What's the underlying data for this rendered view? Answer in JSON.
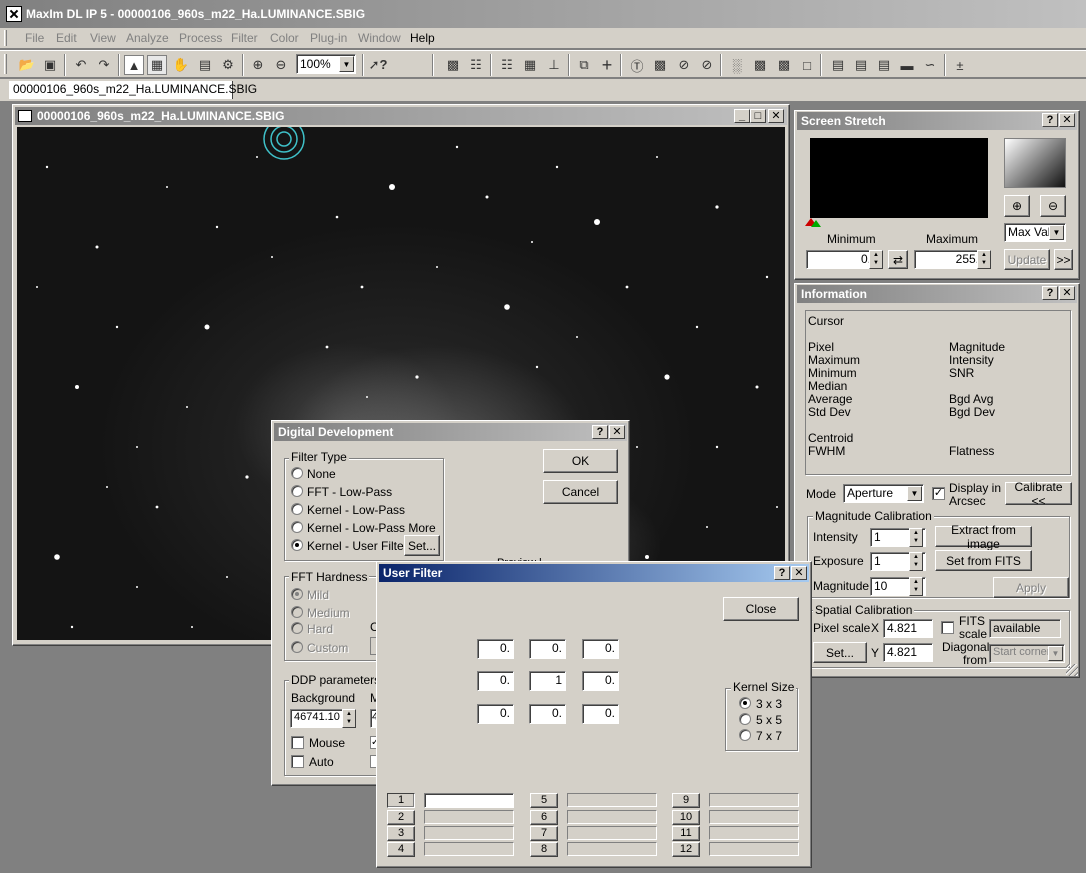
{
  "app": {
    "title": "MaxIm DL IP 5 - 00000106_960s_m22_Ha.LUMINANCE.SBIG",
    "menu": [
      "File",
      "Edit",
      "View",
      "Analyze",
      "Process",
      "Filter",
      "Color",
      "Plug-in",
      "Window",
      "Help"
    ],
    "zoom": "100%",
    "doc_tab": "00000106_960s_m22_Ha.LUMINANCE.SBIG"
  },
  "image_window": {
    "title": "00000106_960s_m22_Ha.LUMINANCE.SBIG"
  },
  "screen_stretch": {
    "title": "Screen Stretch",
    "minimum_label": "Minimum",
    "maximum_label": "Maximum",
    "min_value": "0.",
    "max_value": "255.",
    "mode": "Max Val",
    "update": "Update",
    "more": ">>"
  },
  "information": {
    "title": "Information",
    "cursor": "Cursor",
    "left_labels": [
      "Pixel",
      "Maximum",
      "Minimum",
      "Median",
      "Average",
      "Std Dev"
    ],
    "right_labels": [
      "Magnitude",
      "Intensity",
      "SNR",
      "Bgd Avg",
      "Bgd Dev"
    ],
    "centroid": "Centroid",
    "fwhm": "FWHM",
    "flatness": "Flatness",
    "mode_label": "Mode",
    "mode_value": "Aperture",
    "display_arcsec_1": "Display in",
    "display_arcsec_2": "Arcsec",
    "calibrate": "Calibrate <<",
    "mag_cal_label": "Magnitude Calibration",
    "intensity_label": "Intensity",
    "intensity_value": "1",
    "exposure_label": "Exposure",
    "exposure_value": "1",
    "magnitude_label": "Magnitude",
    "magnitude_value": "10",
    "extract": "Extract from image",
    "set_fits": "Set from FITS",
    "apply": "Apply",
    "spatial_cal_label": "Spatial Calibration",
    "pixel_scale_label": "Pixel scale",
    "x_label": "X",
    "x_value": "4.821",
    "y_label": "Y",
    "y_value": "4.821",
    "fits_scale_1": "FITS",
    "fits_scale_2": "scale",
    "fits_value": "available",
    "diagonal_1": "Diagonal",
    "diagonal_2": "from",
    "start_corner": "Start corner",
    "set": "Set..."
  },
  "digital_development": {
    "title": "Digital Development",
    "filter_type_label": "Filter Type",
    "filter_types": [
      "None",
      "FFT - Low-Pass",
      "Kernel - Low-Pass",
      "Kernel - Low-Pass More",
      "Kernel - User Filter"
    ],
    "set": "Set...",
    "ok": "OK",
    "cancel": "Cancel",
    "partial_label": "Preview l",
    "fft_hardness_label": "FFT Hardness",
    "hardness": [
      "Mild",
      "Medium",
      "Hard",
      "Custom"
    ],
    "partial_c": "C",
    "ddp_label": "DDP parameters",
    "background_label": "Background",
    "background_value": "46741.10",
    "partial_m": "M",
    "partial_4": "4",
    "mouse": "Mouse",
    "auto": "Auto"
  },
  "user_filter": {
    "title": "User Filter",
    "close": "Close",
    "kernel": [
      [
        "0.",
        "0.",
        "0."
      ],
      [
        "0.",
        "1",
        "0."
      ],
      [
        "0.",
        "0.",
        "0."
      ]
    ],
    "kernel_size_label": "Kernel Size",
    "sizes": [
      "3 x 3",
      "5 x 5",
      "7 x 7"
    ],
    "slots": [
      "1",
      "2",
      "3",
      "4",
      "5",
      "6",
      "7",
      "8",
      "9",
      "10",
      "11",
      "12"
    ]
  },
  "colors": {
    "active_title": "#0a246a",
    "active_title_end": "#a6caf0",
    "inactive_title": "#808080",
    "face": "#d4d0c8"
  }
}
